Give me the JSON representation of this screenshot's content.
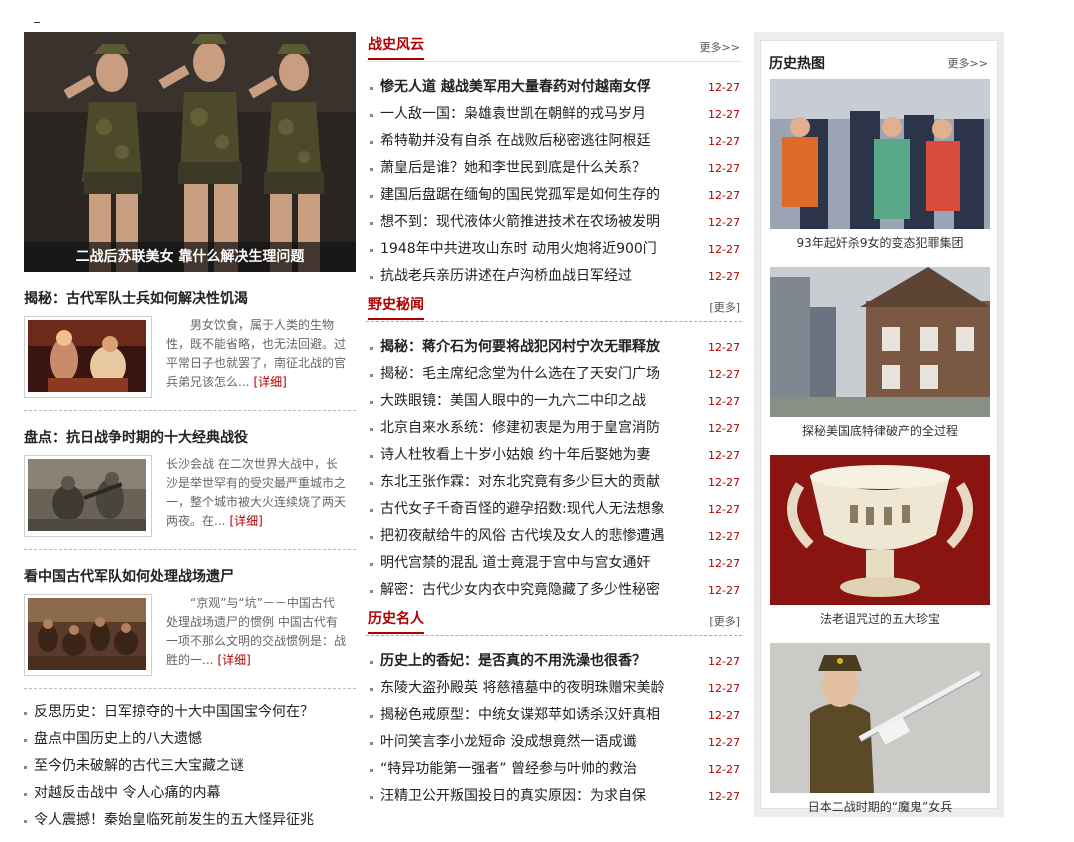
{
  "left": {
    "hero_caption": "二战后苏联美女  靠什么解决生理问题",
    "features": [
      {
        "title": "揭秘：古代军队士兵如何解决性饥渴",
        "summary": "男女饮食，属于人类的生物性，既不能省略，也无法回避。过平常日子也就罢了，南征北战的官兵弟兄该怎么...",
        "detail": "[详细]"
      },
      {
        "title": "盘点：抗日战争时期的十大经典战役",
        "summary": "长沙会战        在二次世界大战中，长沙是举世罕有的受灾最严重城市之一，整个城市被大火连续烧了两天两夜。在...",
        "detail": "[详细]"
      },
      {
        "title": "看中国古代军队如何处理战场遗尸",
        "summary": "“京观”与“坑”－－中国古代处理战场遗尸的惯例      中国古代有一项不那么文明的交战惯例是：战胜的一...",
        "detail": "[详细]"
      }
    ],
    "list": [
      "反思历史：日军掠夺的十大中国国宝今何在？",
      "盘点中国历史上的八大遗憾",
      "至今仍未破解的古代三大宝藏之谜",
      "对越反击战中  令人心痛的内幕",
      "令人震撼！秦始皇临死前发生的五大怪异征兆"
    ]
  },
  "sections": [
    {
      "title": "战史风云",
      "more": "更多>>",
      "items": [
        {
          "text": "惨无人道  越战美军用大量春药对付越南女俘",
          "date": "12-27",
          "lead": true
        },
        {
          "text": "一人敌一国：枭雄袁世凯在朝鲜的戎马岁月",
          "date": "12-27"
        },
        {
          "text": "希特勒并没有自杀  在战败后秘密逃往阿根廷",
          "date": "12-27"
        },
        {
          "text": "萧皇后是谁？她和李世民到底是什么关系？",
          "date": "12-27"
        },
        {
          "text": "建国后盘踞在缅甸的国民党孤军是如何生存的",
          "date": "12-27"
        },
        {
          "text": "想不到：现代液体火箭推进技术在农场被发明",
          "date": "12-27"
        },
        {
          "text": "1948年中共进攻山东时  动用火炮将近900门",
          "date": "12-27"
        },
        {
          "text": "抗战老兵亲历讲述在卢沟桥血战日军经过",
          "date": "12-27"
        }
      ]
    },
    {
      "title": "野史秘闻",
      "more": "[更多]",
      "items": [
        {
          "text": "揭秘：蒋介石为何要将战犯冈村宁次无罪释放",
          "date": "12-27",
          "lead": true
        },
        {
          "text": "揭秘：毛主席纪念堂为什么选在了天安门广场",
          "date": "12-27"
        },
        {
          "text": "大跌眼镜：美国人眼中的一九六二中印之战",
          "date": "12-27"
        },
        {
          "text": "北京自来水系统：修建初衷是为用于皇宫消防",
          "date": "12-27"
        },
        {
          "text": "诗人杜牧看上十岁小姑娘  约十年后娶她为妻",
          "date": "12-27"
        },
        {
          "text": "东北王张作霖：对东北究竟有多少巨大的贡献",
          "date": "12-27"
        },
        {
          "text": "古代女子千奇百怪的避孕招数:现代人无法想象",
          "date": "12-27"
        },
        {
          "text": "把初夜献给牛的风俗  古代埃及女人的悲惨遭遇",
          "date": "12-27"
        },
        {
          "text": "明代宫禁的混乱  道士竟混于宫中与宫女通奸",
          "date": "12-27"
        },
        {
          "text": "解密：古代少女内衣中究竟隐藏了多少性秘密",
          "date": "12-27"
        }
      ]
    },
    {
      "title": "历史名人",
      "more": "[更多]",
      "items": [
        {
          "text": "历史上的香妃：是否真的不用洗澡也很香？",
          "date": "12-27",
          "lead": true
        },
        {
          "text": "东陵大盗孙殿英  将慈禧墓中的夜明珠赠宋美龄",
          "date": "12-27"
        },
        {
          "text": "揭秘色戒原型：中统女谍郑苹如诱杀汉奸真相",
          "date": "12-27"
        },
        {
          "text": "叶问笑言李小龙短命  没成想竟然一语成谶",
          "date": "12-27"
        },
        {
          "text": "“特异功能第一强者”  曾经参与叶帅的救治",
          "date": "12-27"
        },
        {
          "text": "汪精卫公开叛国投日的真实原因：为求自保",
          "date": "12-27"
        }
      ]
    }
  ],
  "right": {
    "title": "历史热图",
    "more": "更多>>",
    "pictures": [
      {
        "caption": "93年起奸杀9女的变态犯罪集团"
      },
      {
        "caption": "探秘美国底特律破产的全过程"
      },
      {
        "caption": "法老诅咒过的五大珍宝"
      },
      {
        "caption": "日本二战时期的“魔鬼”女兵"
      }
    ]
  }
}
